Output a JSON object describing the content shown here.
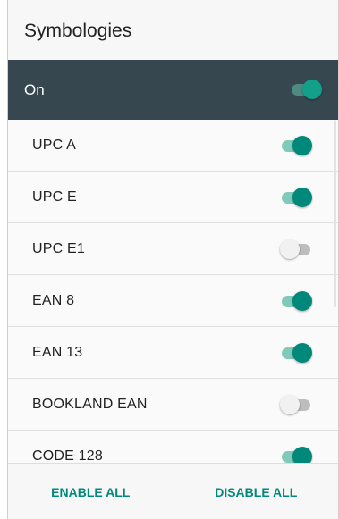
{
  "header": {
    "title": "Symbologies"
  },
  "master": {
    "label": "On",
    "enabled": true
  },
  "symbologies": [
    {
      "label": "UPC A",
      "enabled": true
    },
    {
      "label": "UPC E",
      "enabled": true
    },
    {
      "label": "UPC E1",
      "enabled": false
    },
    {
      "label": "EAN 8",
      "enabled": true
    },
    {
      "label": "EAN 13",
      "enabled": true
    },
    {
      "label": "BOOKLAND EAN",
      "enabled": false
    },
    {
      "label": "CODE 128",
      "enabled": true
    }
  ],
  "footer": {
    "enable_all_label": "ENABLE ALL",
    "disable_all_label": "DISABLE ALL"
  },
  "colors": {
    "accent": "#00897b",
    "header_bar": "#37474f"
  }
}
